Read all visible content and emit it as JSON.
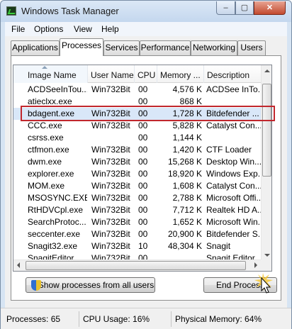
{
  "window": {
    "title": "Windows Task Manager"
  },
  "caption": {
    "minimize": "–",
    "maximize": "▢",
    "close": "✕"
  },
  "menu": [
    "File",
    "Options",
    "View",
    "Help"
  ],
  "tabs": [
    "Applications",
    "Processes",
    "Services",
    "Performance",
    "Networking",
    "Users"
  ],
  "active_tab": "Processes",
  "columns": [
    "Image Name",
    "User Name",
    "CPU",
    "Memory ...",
    "Description"
  ],
  "processes": [
    {
      "name": "ACDSeeInTou...",
      "user": "Win732Bit",
      "cpu": "00",
      "mem": "4,576 K",
      "desc": "ACDSee InTo..."
    },
    {
      "name": "atieclxx.exe",
      "user": "",
      "cpu": "00",
      "mem": "868 K",
      "desc": ""
    },
    {
      "name": "bdagent.exe",
      "user": "Win732Bit",
      "cpu": "00",
      "mem": "1,728 K",
      "desc": "Bitdefender ..."
    },
    {
      "name": "CCC.exe",
      "user": "Win732Bit",
      "cpu": "00",
      "mem": "5,828 K",
      "desc": "Catalyst Con..."
    },
    {
      "name": "csrss.exe",
      "user": "",
      "cpu": "00",
      "mem": "1,144 K",
      "desc": ""
    },
    {
      "name": "ctfmon.exe",
      "user": "Win732Bit",
      "cpu": "00",
      "mem": "1,420 K",
      "desc": "CTF Loader"
    },
    {
      "name": "dwm.exe",
      "user": "Win732Bit",
      "cpu": "00",
      "mem": "15,268 K",
      "desc": "Desktop Win..."
    },
    {
      "name": "explorer.exe",
      "user": "Win732Bit",
      "cpu": "00",
      "mem": "18,920 K",
      "desc": "Windows Exp..."
    },
    {
      "name": "MOM.exe",
      "user": "Win732Bit",
      "cpu": "00",
      "mem": "1,608 K",
      "desc": "Catalyst Con..."
    },
    {
      "name": "MSOSYNC.EXE",
      "user": "Win732Bit",
      "cpu": "00",
      "mem": "2,788 K",
      "desc": "Microsoft Offi..."
    },
    {
      "name": "RtHDVCpl.exe",
      "user": "Win732Bit",
      "cpu": "00",
      "mem": "7,712 K",
      "desc": "Realtek HD A..."
    },
    {
      "name": "SearchProtoc...",
      "user": "Win732Bit",
      "cpu": "00",
      "mem": "1,652 K",
      "desc": "Microsoft Win..."
    },
    {
      "name": "seccenter.exe",
      "user": "Win732Bit",
      "cpu": "00",
      "mem": "20,900 K",
      "desc": "Bitdefender S..."
    },
    {
      "name": "Snagit32.exe",
      "user": "Win732Bit",
      "cpu": "10",
      "mem": "48,304 K",
      "desc": "Snagit"
    },
    {
      "name": "SnagitEditor...",
      "user": "Win732Bit",
      "cpu": "00",
      "mem": "",
      "desc": "Snagit Editor"
    }
  ],
  "selected_process": "bdagent.exe",
  "buttons": {
    "show_all": "Show processes from all users",
    "end_process": "End Process"
  },
  "status": {
    "processes": "Processes: 65",
    "cpu": "CPU Usage: 16%",
    "memory": "Physical Memory: 64%"
  },
  "colors": {
    "highlight": "#c1272d",
    "selection": "#d9e7f8",
    "window_frame": "#d6e4f3"
  }
}
